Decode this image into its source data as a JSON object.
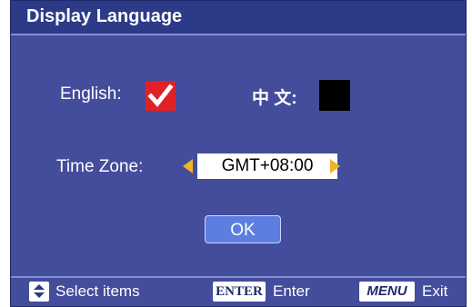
{
  "title": "Display Language",
  "language": {
    "english_label": "English:",
    "english_checked": true,
    "chinese_label": "中 文:",
    "chinese_checked": false
  },
  "timezone": {
    "label": "Time Zone:",
    "value": "GMT+08:00"
  },
  "ok_label": "OK",
  "footer": {
    "select_label": "Select items",
    "enter_key": "ENTER",
    "enter_label": "Enter",
    "menu_key": "MENU",
    "exit_label": "Exit"
  },
  "colors": {
    "panel_bg": "#444c9c",
    "title_bg": "#2c3a88",
    "checkbox_red": "#e02226",
    "arrow_yellow": "#f0b428",
    "ok_button": "#5c7ee0"
  }
}
